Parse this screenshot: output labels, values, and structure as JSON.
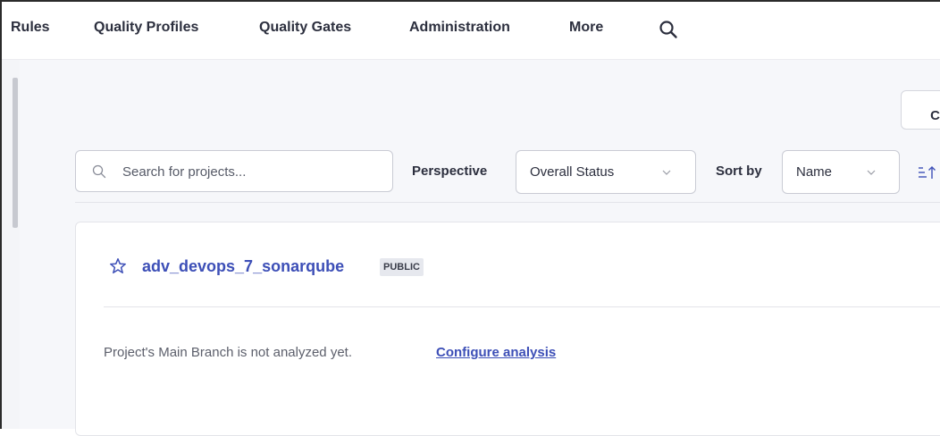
{
  "nav": {
    "items": [
      {
        "label": "Rules"
      },
      {
        "label": "Quality Profiles"
      },
      {
        "label": "Quality Gates"
      },
      {
        "label": "Administration"
      },
      {
        "label": "More"
      }
    ],
    "search_icon": "search-icon"
  },
  "toolbar": {
    "create_label": "Cr",
    "search_placeholder": "Search for projects...",
    "perspective_label": "Perspective",
    "perspective_value": "Overall Status",
    "sort_label": "Sort by",
    "sort_value": "Name",
    "sort_direction_icon": "sort-ascending-icon"
  },
  "project": {
    "name": "adv_devops_7_sonarqube",
    "visibility": "PUBLIC",
    "favorite_icon": "star-outline-icon",
    "status_text": "Project's Main Branch is not analyzed yet.",
    "configure_link": "Configure analysis"
  },
  "colors": {
    "link": "#3d4fb7",
    "background": "#f6f7fa",
    "border": "#c9cbd4"
  }
}
